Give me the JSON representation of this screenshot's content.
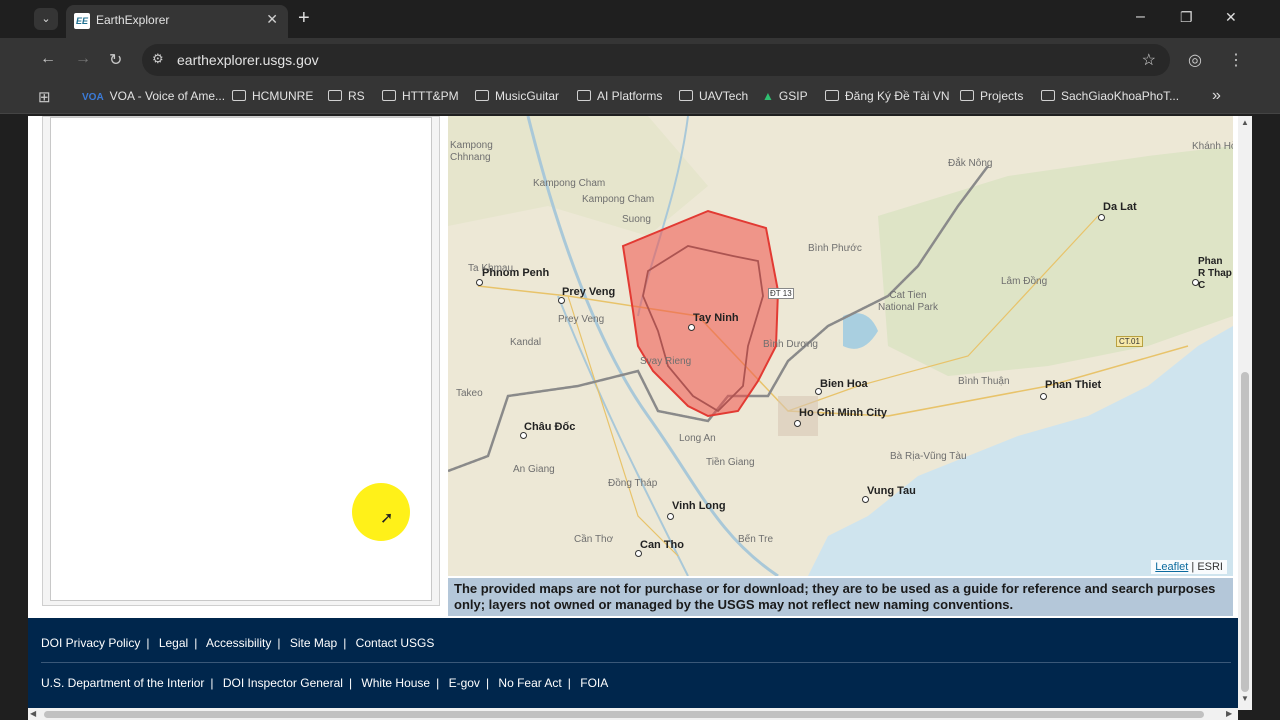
{
  "browser": {
    "tab_title": "EarthExplorer",
    "favicon_text": "EE",
    "tab_close": "✕",
    "new_tab": "+",
    "url": "earthexplorer.usgs.gov",
    "window_controls": [
      "–",
      "❐",
      "✕"
    ],
    "bookmarks": [
      {
        "label": "VOA - Voice of Ame...",
        "icon": "voa-icon"
      },
      {
        "label": "HCMUNRE",
        "icon": "folder-icon"
      },
      {
        "label": "RS",
        "icon": "folder-icon"
      },
      {
        "label": "HTTT&PM",
        "icon": "folder-icon"
      },
      {
        "label": "MusicGuitar",
        "icon": "folder-icon"
      },
      {
        "label": "AI Platforms",
        "icon": "folder-icon"
      },
      {
        "label": "UAVTech",
        "icon": "folder-icon"
      },
      {
        "label": "GSIP",
        "icon": "gsip-icon"
      },
      {
        "label": "Đăng Ký Đề Tài VN",
        "icon": "folder-icon"
      },
      {
        "label": "Projects",
        "icon": "folder-icon"
      },
      {
        "label": "SachGiaoKhoaPhoT...",
        "icon": "folder-icon"
      }
    ]
  },
  "map": {
    "cities": [
      {
        "name": "Phnom Penh"
      },
      {
        "name": "Prey Veng"
      },
      {
        "name": "Tay Ninh"
      },
      {
        "name": "Bien Hoa"
      },
      {
        "name": "Ho Chi Minh City"
      },
      {
        "name": "Châu Đốc"
      },
      {
        "name": "Vinh Long"
      },
      {
        "name": "Can Tho"
      },
      {
        "name": "Vung Tau"
      },
      {
        "name": "Phan Thiet"
      },
      {
        "name": "Da Lat"
      },
      {
        "name": "Phan R Thap C"
      }
    ],
    "region_labels": [
      "Kampong Chhnang",
      "Kampong Cham",
      "Suong",
      "Kampong Cham",
      "Ta Khmau",
      "Prey Veng",
      "Kandal",
      "Takeo",
      "Svay Rieng",
      "Long An",
      "An Giang",
      "Đồng Tháp",
      "Tiền Giang",
      "Cần Thơ",
      "Bến Tre",
      "Bình Phước",
      "Bình Dương",
      "Cat Tien National Park",
      "Lâm Đồng",
      "Bình Thuận",
      "Bà Rịa-Vũng Tàu",
      "Đắk Nông",
      "Khánh Hòa",
      "ĐT 13",
      "CT.01"
    ],
    "attribution_link": "Leaflet",
    "attribution_sep": "|",
    "attribution_text": "ESRI",
    "overlay_color": "#f0504a"
  },
  "disclaimer": "The provided maps are not for purchase or for download; they are to be used as a guide for reference and search purposes only; layers not owned or managed by the USGS may not reflect new naming conventions.",
  "footer": {
    "row1": [
      "DOI Privacy Policy",
      "Legal",
      "Accessibility",
      "Site Map",
      "Contact USGS"
    ],
    "row2": [
      "U.S. Department of the Interior",
      "DOI Inspector General",
      "White House",
      "E-gov",
      "No Fear Act",
      "FOIA"
    ],
    "separator": "|"
  }
}
